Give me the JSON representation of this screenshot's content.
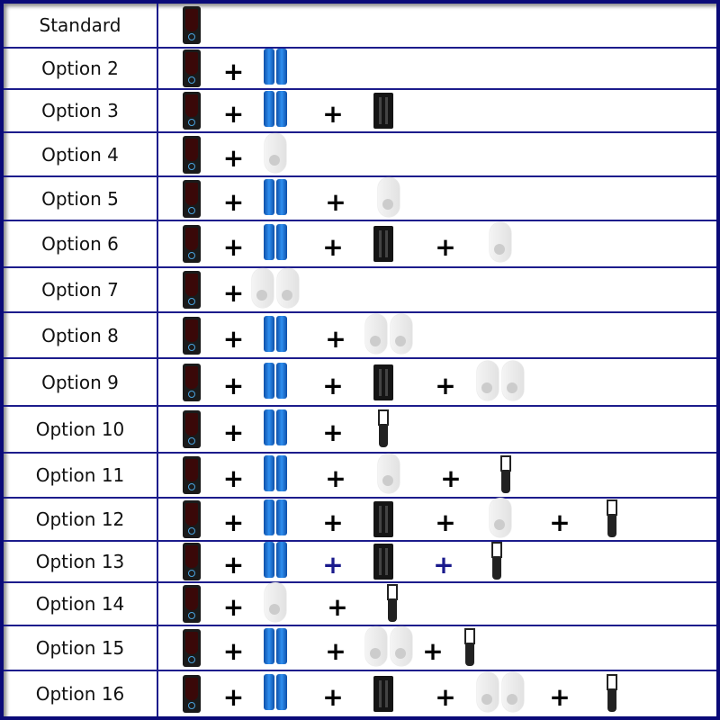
{
  "colors": {
    "border": "#0a0a78",
    "plus_default": "#000000",
    "plus_accent": "#1a1a8c"
  },
  "rows": [
    {
      "label": "Standard",
      "items": [
        "doorbell"
      ]
    },
    {
      "label": "Option 2",
      "items": [
        "doorbell",
        "battery-pair"
      ]
    },
    {
      "label": "Option 3",
      "items": [
        "doorbell",
        "battery-pair",
        "charger"
      ]
    },
    {
      "label": "Option 4",
      "items": [
        "doorbell",
        "chime"
      ]
    },
    {
      "label": "Option 5",
      "items": [
        "doorbell",
        "battery-pair",
        "chime"
      ]
    },
    {
      "label": "Option 6",
      "items": [
        "doorbell",
        "battery-pair",
        "charger",
        "chime"
      ]
    },
    {
      "label": "Option 7",
      "items": [
        "doorbell",
        "chime-pair"
      ]
    },
    {
      "label": "Option 8",
      "items": [
        "doorbell",
        "battery-pair",
        "chime-pair"
      ]
    },
    {
      "label": "Option 9",
      "items": [
        "doorbell",
        "battery-pair",
        "charger",
        "chime-pair"
      ]
    },
    {
      "label": "Option 10",
      "items": [
        "doorbell",
        "battery-pair",
        "car-charger"
      ]
    },
    {
      "label": "Option 11",
      "items": [
        "doorbell",
        "battery-pair",
        "chime",
        "car-charger"
      ]
    },
    {
      "label": "Option 12",
      "items": [
        "doorbell",
        "battery-pair",
        "charger",
        "chime",
        "car-charger"
      ]
    },
    {
      "label": "Option 13",
      "items": [
        "doorbell",
        "battery-pair",
        "charger",
        "car-charger"
      ],
      "accent_plus": [
        1,
        2
      ]
    },
    {
      "label": "Option 14",
      "items": [
        "doorbell",
        "chime",
        "car-charger"
      ]
    },
    {
      "label": "Option 15",
      "items": [
        "doorbell",
        "battery-pair",
        "chime-pair",
        "car-charger"
      ]
    },
    {
      "label": "Option 16",
      "items": [
        "doorbell",
        "battery-pair",
        "charger",
        "chime-pair",
        "car-charger"
      ]
    }
  ],
  "plus_symbol": "+"
}
